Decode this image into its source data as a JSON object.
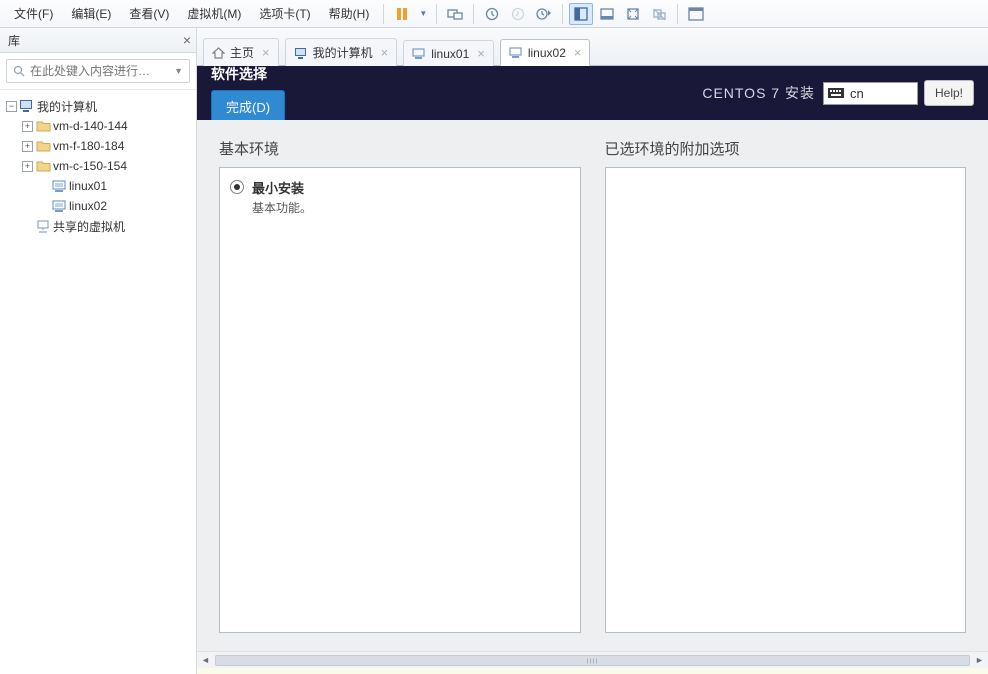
{
  "menus": {
    "file": "文件(F)",
    "edit": "编辑(E)",
    "view": "查看(V)",
    "vm": "虚拟机(M)",
    "tabs": "选项卡(T)",
    "help": "帮助(H)"
  },
  "sidebar": {
    "title": "库",
    "search_placeholder": "在此处键入内容进行…",
    "root": "我的计算机",
    "folders": [
      "vm-d-140-144",
      "vm-f-180-184",
      "vm-c-150-154"
    ],
    "vms": [
      "linux01",
      "linux02"
    ],
    "shared": "共享的虚拟机"
  },
  "tabs": [
    {
      "label": "主页",
      "icon": "home"
    },
    {
      "label": "我的计算机",
      "icon": "monitor"
    },
    {
      "label": "linux01",
      "icon": "vm"
    },
    {
      "label": "linux02",
      "icon": "vm",
      "active": true
    }
  ],
  "installer": {
    "header_title": "软件选择",
    "brand": "CENTOS 7 安装",
    "done": "完成(D)",
    "keyboard": "cn",
    "help": "Help!",
    "left_title": "基本环境",
    "right_title": "已选环境的附加选项",
    "option_title": "最小安装",
    "option_desc": "基本功能。"
  }
}
